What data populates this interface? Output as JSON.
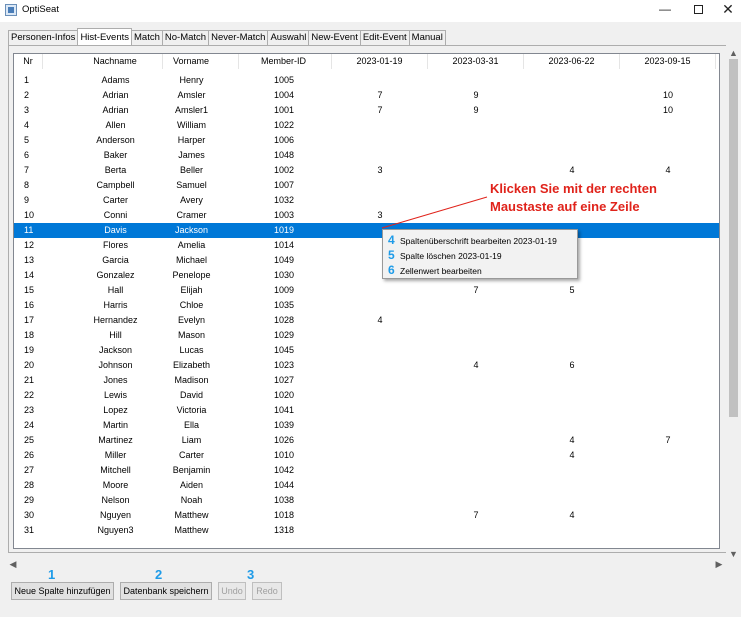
{
  "window": {
    "title": "OptiSeat",
    "minimize": "—",
    "close": "✕"
  },
  "tabs": [
    {
      "label": "Personen-Infos"
    },
    {
      "label": "Hist-Events",
      "active": true
    },
    {
      "label": "Match"
    },
    {
      "label": "No-Match"
    },
    {
      "label": "Never-Match"
    },
    {
      "label": "Auswahl"
    },
    {
      "label": "New-Event"
    },
    {
      "label": "Edit-Event"
    },
    {
      "label": "Manual"
    }
  ],
  "table": {
    "columns": [
      "Nr",
      "Nachname",
      "Vorname",
      "Member-ID",
      "2023-01-19",
      "2023-03-31",
      "2023-06-22",
      "2023-09-15"
    ],
    "selected_row": 10,
    "rows": [
      [
        "1",
        "Adams",
        "Henry",
        "1005",
        "",
        "",
        "",
        ""
      ],
      [
        "2",
        "Adrian",
        "Amsler",
        "1004",
        "7",
        "9",
        "",
        "10"
      ],
      [
        "3",
        "Adrian",
        "Amsler1",
        "1001",
        "7",
        "9",
        "",
        "10"
      ],
      [
        "4",
        "Allen",
        "William",
        "1022",
        "",
        "",
        "",
        ""
      ],
      [
        "5",
        "Anderson",
        "Harper",
        "1006",
        "",
        "",
        "",
        ""
      ],
      [
        "6",
        "Baker",
        "James",
        "1048",
        "",
        "",
        "",
        ""
      ],
      [
        "7",
        "Berta",
        "Beller",
        "1002",
        "3",
        "",
        "4",
        "4"
      ],
      [
        "8",
        "Campbell",
        "Samuel",
        "1007",
        "",
        "",
        "",
        ""
      ],
      [
        "9",
        "Carter",
        "Avery",
        "1032",
        "",
        "",
        "",
        ""
      ],
      [
        "10",
        "Conni",
        "Cramer",
        "1003",
        "3",
        "",
        "",
        ""
      ],
      [
        "11",
        "Davis",
        "Jackson",
        "1019",
        "",
        "",
        "",
        ""
      ],
      [
        "12",
        "Flores",
        "Amelia",
        "1014",
        "",
        "",
        "",
        ""
      ],
      [
        "13",
        "Garcia",
        "Michael",
        "1049",
        "",
        "",
        "",
        ""
      ],
      [
        "14",
        "Gonzalez",
        "Penelope",
        "1030",
        "",
        "",
        "",
        ""
      ],
      [
        "15",
        "Hall",
        "Elijah",
        "1009",
        "",
        "7",
        "5",
        ""
      ],
      [
        "16",
        "Harris",
        "Chloe",
        "1035",
        "",
        "",
        "",
        ""
      ],
      [
        "17",
        "Hernandez",
        "Evelyn",
        "1028",
        "4",
        "",
        "",
        ""
      ],
      [
        "18",
        "Hill",
        "Mason",
        "1029",
        "",
        "",
        "",
        ""
      ],
      [
        "19",
        "Jackson",
        "Lucas",
        "1045",
        "",
        "",
        "",
        ""
      ],
      [
        "20",
        "Johnson",
        "Elizabeth",
        "1023",
        "",
        "4",
        "6",
        ""
      ],
      [
        "21",
        "Jones",
        "Madison",
        "1027",
        "",
        "",
        "",
        ""
      ],
      [
        "22",
        "Lewis",
        "David",
        "1020",
        "",
        "",
        "",
        ""
      ],
      [
        "23",
        "Lopez",
        "Victoria",
        "1041",
        "",
        "",
        "",
        ""
      ],
      [
        "24",
        "Martin",
        "Ella",
        "1039",
        "",
        "",
        "",
        ""
      ],
      [
        "25",
        "Martinez",
        "Liam",
        "1026",
        "",
        "",
        "4",
        "7"
      ],
      [
        "26",
        "Miller",
        "Carter",
        "1010",
        "",
        "",
        "4",
        ""
      ],
      [
        "27",
        "Mitchell",
        "Benjamin",
        "1042",
        "",
        "",
        "",
        ""
      ],
      [
        "28",
        "Moore",
        "Aiden",
        "1044",
        "",
        "",
        "",
        ""
      ],
      [
        "29",
        "Nelson",
        "Noah",
        "1038",
        "",
        "",
        "",
        ""
      ],
      [
        "30",
        "Nguyen",
        "Matthew",
        "1018",
        "",
        "7",
        "4",
        ""
      ],
      [
        "31",
        "Nguyen3",
        "Matthew",
        "1318",
        "",
        "",
        "",
        ""
      ]
    ]
  },
  "context_menu": {
    "items": [
      {
        "num": "4",
        "label": "Spaltenüberschrift bearbeiten 2023-01-19"
      },
      {
        "num": "5",
        "label": "Spalte löschen 2023-01-19"
      },
      {
        "num": "6",
        "label": "Zellenwert bearbeiten"
      }
    ]
  },
  "annotation": {
    "line1": "Klicken Sie mit der rechten",
    "line2": "Maustaste auf eine Zeile",
    "color": "#e0231b"
  },
  "buttons": [
    {
      "num": "1",
      "label": "Neue Spalte hinzufügen",
      "enabled": true
    },
    {
      "num": "2",
      "label": "Datenbank speichern",
      "enabled": true
    },
    {
      "num": "3",
      "label": "Undo",
      "enabled": false
    },
    {
      "num": "",
      "label": "Redo",
      "enabled": false
    }
  ],
  "colors": {
    "selection": "#0078d7",
    "step_numbers": "#1e9be8"
  }
}
